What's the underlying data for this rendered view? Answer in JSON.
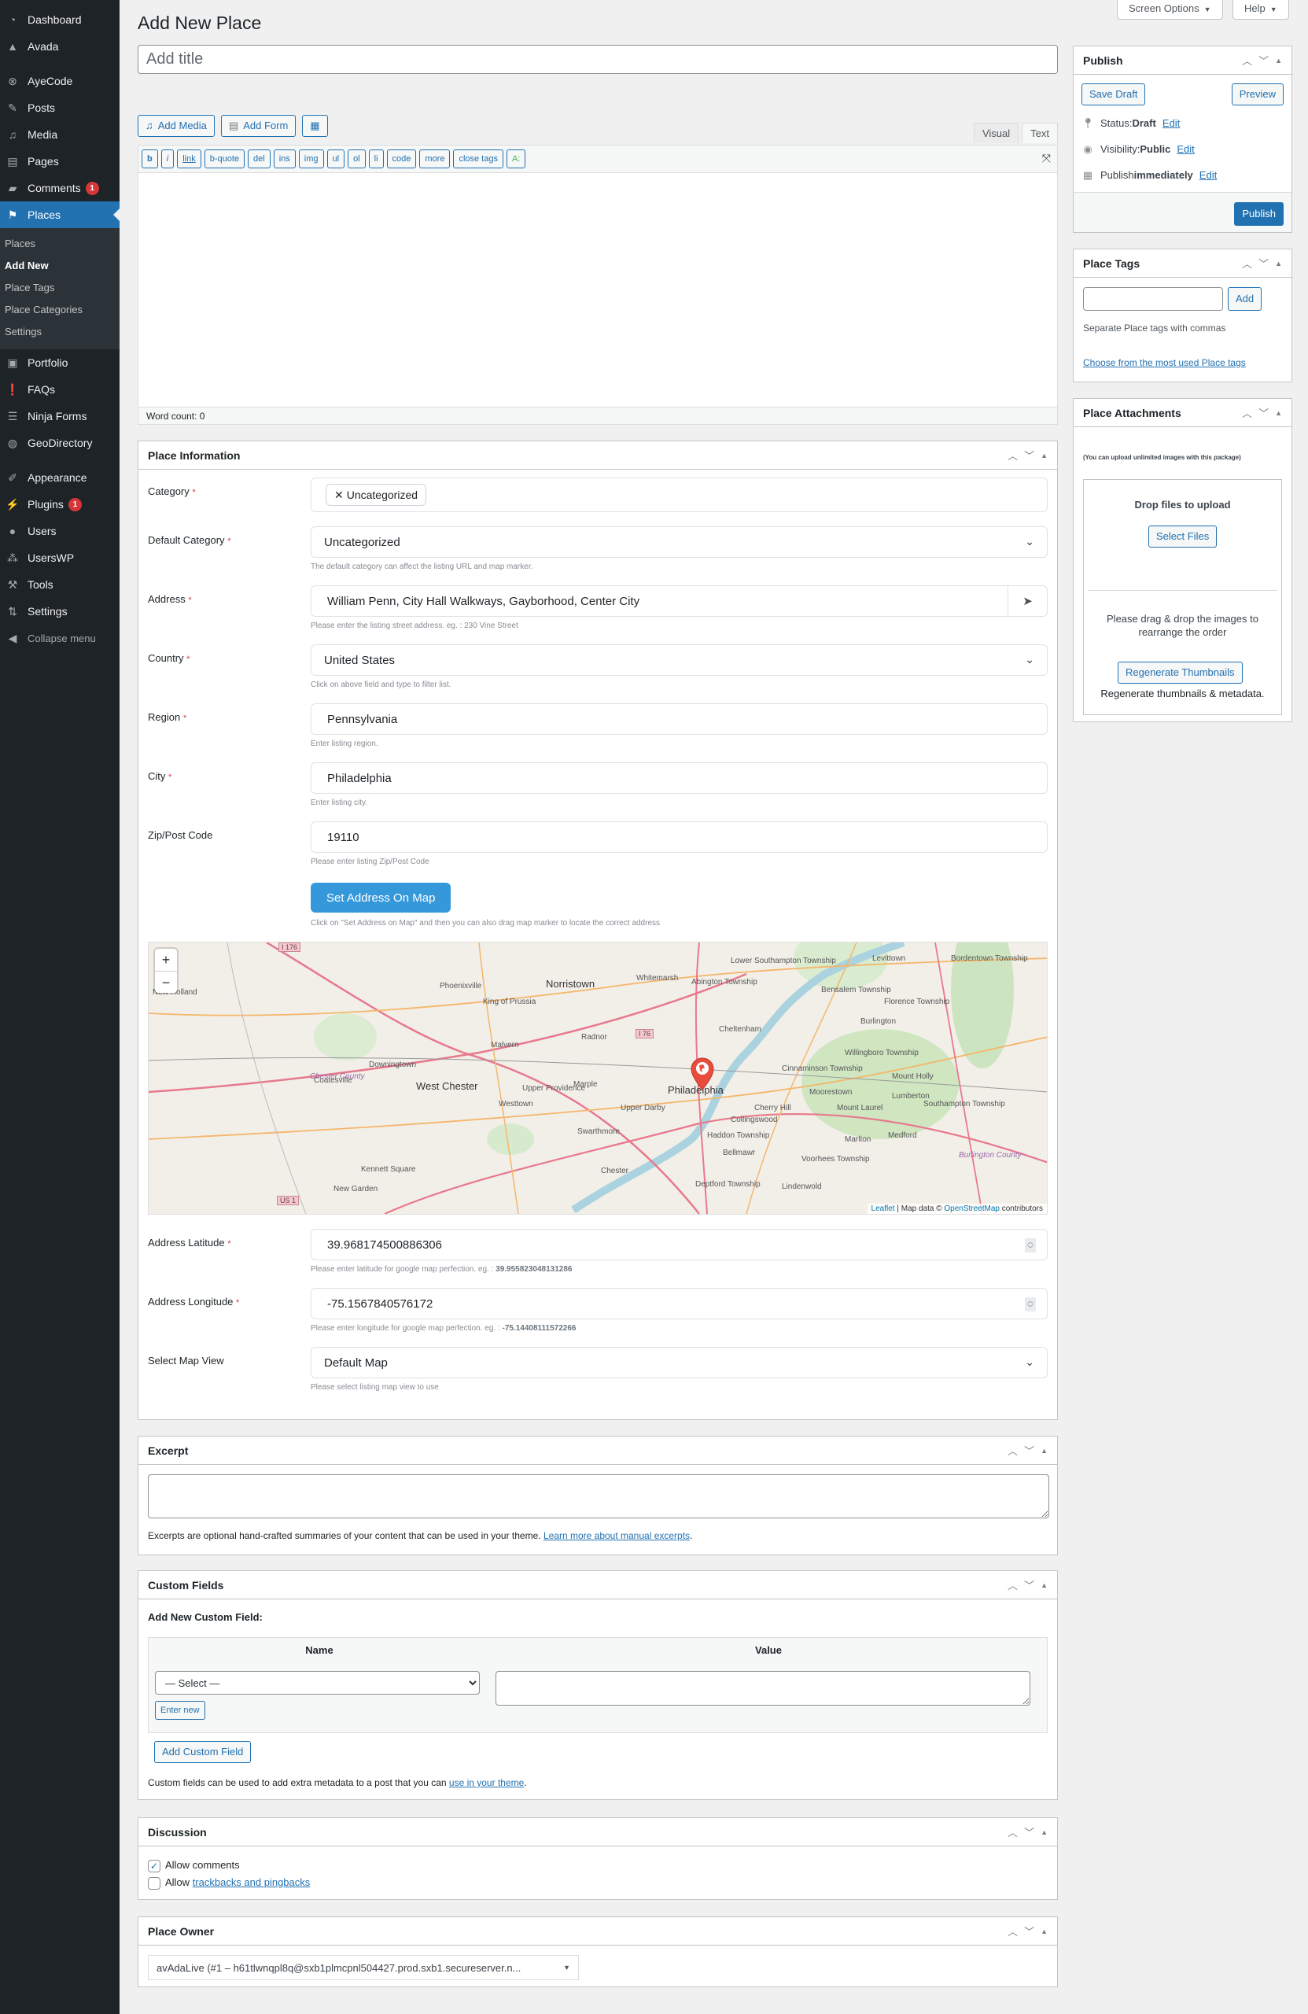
{
  "sidebar": {
    "items": [
      {
        "label": "Dashboard",
        "icon": "dashboard-icon"
      },
      {
        "label": "Avada",
        "icon": "avada-icon"
      },
      {
        "label": "AyeCode",
        "icon": "ayecode-icon"
      },
      {
        "label": "Posts",
        "icon": "pin-icon"
      },
      {
        "label": "Media",
        "icon": "media-icon"
      },
      {
        "label": "Pages",
        "icon": "pages-icon"
      },
      {
        "label": "Comments",
        "icon": "comment-icon",
        "badge": "1"
      },
      {
        "label": "Places",
        "icon": "places-map-icon"
      },
      {
        "label": "Portfolio",
        "icon": "portfolio-icon"
      },
      {
        "label": "FAQs",
        "icon": "exclamation-icon"
      },
      {
        "label": "Ninja Forms",
        "icon": "forms-icon"
      },
      {
        "label": "GeoDirectory",
        "icon": "globe-icon"
      },
      {
        "label": "Appearance",
        "icon": "paintbrush-icon"
      },
      {
        "label": "Plugins",
        "icon": "plugin-icon",
        "badge": "1"
      },
      {
        "label": "Users",
        "icon": "user-icon"
      },
      {
        "label": "UsersWP",
        "icon": "users-group-icon"
      },
      {
        "label": "Tools",
        "icon": "wrench-icon"
      },
      {
        "label": "Settings",
        "icon": "settings-sliders-icon"
      },
      {
        "label": "Collapse menu",
        "icon": "collapse-icon"
      }
    ],
    "submenu": [
      "Places",
      "Add New",
      "Place Tags",
      "Place Categories",
      "Settings"
    ]
  },
  "screen_meta": {
    "screen_options": "Screen Options",
    "help": "Help"
  },
  "page": {
    "title": "Add New Place",
    "title_placeholder": "Add title"
  },
  "editor": {
    "add_media": "Add Media",
    "add_form": "Add Form",
    "tab_visual": "Visual",
    "tab_text": "Text",
    "quicktags": [
      "b",
      "i",
      "link",
      "b-quote",
      "del",
      "ins",
      "img",
      "ul",
      "ol",
      "li",
      "code",
      "more",
      "close tags",
      "A:"
    ],
    "word_count": "Word count: 0"
  },
  "place_info": {
    "title": "Place Information",
    "category_label": "Category",
    "category_tag": "Uncategorized",
    "default_category_label": "Default Category",
    "default_category_value": "Uncategorized",
    "default_category_help": "The default category can affect the listing URL and map marker.",
    "address_label": "Address",
    "address_value": "William Penn, City Hall Walkways, Gayborhood, Center City",
    "address_help": "Please enter the listing street address. eg. : 230 Vine Street",
    "country_label": "Country",
    "country_value": "United States",
    "country_help": "Click on above field and type to filter list.",
    "region_label": "Region",
    "region_value": "Pennsylvania",
    "region_help": "Enter listing region.",
    "city_label": "City",
    "city_value": "Philadelphia",
    "city_help": "Enter listing city.",
    "zip_label": "Zip/Post Code",
    "zip_value": "19110",
    "zip_help": "Please enter listing Zip/Post Code",
    "set_map_button": "Set Address On Map",
    "set_map_help": "Click on \"Set Address on Map\" and then you can also drag map marker to locate the correct address",
    "latitude_label": "Address Latitude",
    "latitude_value": "39.968174500886306",
    "latitude_help": "Please enter latitude for google map perfection. eg. : ",
    "latitude_example": "39.955823048131286",
    "longitude_label": "Address Longitude",
    "longitude_value": "-75.1567840576172",
    "longitude_help": "Please enter longitude for google map perfection. eg. : ",
    "longitude_example": "-75.14408111572266",
    "map_view_label": "Select Map View",
    "map_view_value": "Default Map",
    "map_view_help": "Please select listing map view to use"
  },
  "map": {
    "zoom_in": "+",
    "zoom_out": "−",
    "attribution_leaflet": "Leaflet",
    "attribution_text": " | Map data © ",
    "attribution_osm": "OpenStreetMap",
    "attribution_suffix": " contributors",
    "labels": [
      "Phoenixville",
      "Norristown",
      "Whitemarsh",
      "Abington Township",
      "Lower Southampton Township",
      "Levittown",
      "Bordentown Township",
      "Bensalem Township",
      "Florence Township",
      "King of Prussia",
      "Burlington",
      "Cheltenham",
      "Radnor",
      "Malvern",
      "Willingboro Township",
      "Downingtown",
      "Coatesville",
      "Cinnaminson Township",
      "Mount Holly",
      "Marple",
      "West Chester",
      "Upper Providence",
      "Philadelphia",
      "Moorestown",
      "Lumberton",
      "Westtown",
      "Upper Darby",
      "Cherry Hill",
      "Mount Laurel",
      "Southampton Township",
      "Collingswood",
      "Swarthmore",
      "Haddon Township",
      "Marlton",
      "Medford",
      "Bellmawr",
      "Kennett Square",
      "Chester",
      "Voorhees Township",
      "New Garden",
      "Deptford Township",
      "Lindenwold",
      "New Holland"
    ],
    "counties": [
      "Chester County",
      "Burlington County"
    ],
    "shields": [
      "I 176",
      "I 76",
      "US 1"
    ]
  },
  "publish": {
    "title": "Publish",
    "save_draft": "Save Draft",
    "preview": "Preview",
    "status_label": "Status: ",
    "status_value": "Draft",
    "visibility_label": "Visibility: ",
    "visibility_value": "Public",
    "publish_label": "Publish ",
    "publish_value": "immediately",
    "edit": "Edit",
    "publish_button": "Publish"
  },
  "place_tags": {
    "title": "Place Tags",
    "add": "Add",
    "help": "Separate Place tags with commas",
    "choose_link": "Choose from the most used Place tags"
  },
  "attachments": {
    "title": "Place Attachments",
    "note": "(You can upload unlimited images with this package)",
    "drop": "Drop files to upload",
    "select_files": "Select Files",
    "rearrange": "Please drag & drop the images to rearrange the order",
    "regenerate": "Regenerate Thumbnails",
    "regenerate_help": "Regenerate thumbnails & metadata."
  },
  "excerpt": {
    "title": "Excerpt",
    "help": "Excerpts are optional hand-crafted summaries of your content that can be used in your theme. ",
    "link": "Learn more about manual excerpts",
    "period": "."
  },
  "custom_fields": {
    "title": "Custom Fields",
    "add_new": "Add New Custom Field:",
    "col_name": "Name",
    "col_value": "Value",
    "select": "— Select —",
    "enter_new": "Enter new",
    "add_button": "Add Custom Field",
    "help": "Custom fields can be used to add extra metadata to a post that you can ",
    "link": "use in your theme",
    "period": "."
  },
  "discussion": {
    "title": "Discussion",
    "allow_comments": "Allow comments",
    "allow_comments_checked": true,
    "allow_prefix": "Allow ",
    "trackbacks_link": "trackbacks and pingbacks",
    "trackbacks_checked": false
  },
  "owner": {
    "title": "Place Owner",
    "value": "avAdaLive (#1 – h61tlwnqpl8q@sxb1plmcpnl504427.prod.sxb1.secureserver.n..."
  }
}
